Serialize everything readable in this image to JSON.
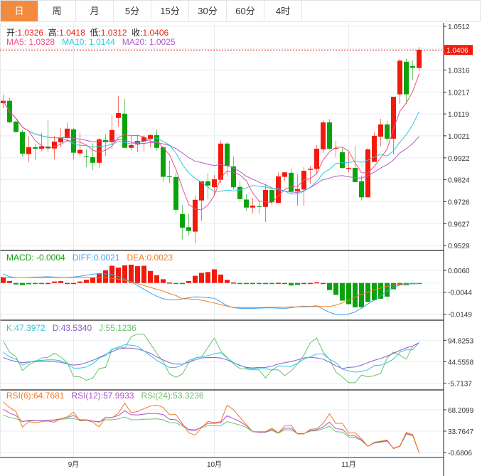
{
  "tabs": [
    {
      "label": "日",
      "active": true
    },
    {
      "label": "周"
    },
    {
      "label": "月"
    },
    {
      "label": "5分"
    },
    {
      "label": "15分"
    },
    {
      "label": "30分"
    },
    {
      "label": "60分"
    },
    {
      "label": "4时"
    }
  ],
  "legend": {
    "open_label": "开:",
    "open": "1.0326",
    "high_label": "高:",
    "high": "1.0418",
    "low_label": "低:",
    "low": "1.0312",
    "close_label": "收:",
    "close": "1.0406",
    "ma5": "MA5: 1.0328",
    "ma10": "MA10: 1.0144",
    "ma20": "MA20: 1.0025",
    "macd": "MACD: -0.0004",
    "diff": "DIFF:0.0021",
    "dea": "DEA:0.0023",
    "k": "K:47.3972",
    "d": "D:43.5340",
    "j": "J:55.1236",
    "rsi6": "RSI(6):64.7681",
    "rsi12": "RSI(12):57.9933",
    "rsi24": "RSI(24):53.3236"
  },
  "colors": {
    "up": "#f21a0a",
    "down": "#0ba30b",
    "ma5": "#f0508a",
    "ma10": "#2fc6dc",
    "ma20": "#b35ccb",
    "diff": "#3fa3f0",
    "dea": "#f57a1f",
    "k": "#2fc6dc",
    "d": "#8a5cd0",
    "j": "#6cc06c",
    "rsi6": "#f57a1f",
    "rsi12": "#b04fd0",
    "rsi24": "#6cc06c",
    "tab_active": "#f28b3e"
  },
  "chart_data": [
    {
      "type": "candlestick",
      "title": "Daily K-line",
      "current_price": "1.0406",
      "y_ticks": [
        "1.0512",
        "1.0316",
        "1.0217",
        "1.0119",
        "1.0021",
        "0.9922",
        "0.9824",
        "0.9726",
        "0.9627",
        "0.9529"
      ],
      "ylim": [
        0.9529,
        1.0512
      ],
      "x_ticks": [
        {
          "label": "9月",
          "index": 11
        },
        {
          "label": "10月",
          "index": 33
        },
        {
          "label": "11月",
          "index": 54
        }
      ],
      "ma_periods": [
        5,
        10,
        20
      ],
      "ohlc_columns": [
        "open",
        "close",
        "high",
        "low"
      ],
      "ohlc": [
        [
          1.0167,
          1.0178,
          1.0206,
          1.0145
        ],
        [
          1.0178,
          1.0082,
          1.019,
          1.0078
        ],
        [
          1.0085,
          1.0038,
          1.0095,
          1.0034
        ],
        [
          1.0038,
          0.9941,
          1.0047,
          0.9928
        ],
        [
          0.9939,
          0.997,
          1.0018,
          0.9903
        ],
        [
          0.997,
          0.9963,
          0.9982,
          0.9912
        ],
        [
          0.9963,
          0.9974,
          1.0034,
          0.9951
        ],
        [
          0.9973,
          0.9966,
          1.009,
          0.9947
        ],
        [
          0.9964,
          0.9995,
          1.0021,
          0.9916
        ],
        [
          0.9992,
          1.0014,
          1.0056,
          0.9969
        ],
        [
          1.0011,
          1.0053,
          1.008,
          0.9994
        ],
        [
          1.005,
          0.9945,
          1.0056,
          0.9915
        ],
        [
          0.9942,
          0.9958,
          1.0034,
          0.9928
        ],
        [
          0.9929,
          0.9927,
          0.996,
          0.988
        ],
        [
          0.9925,
          0.99,
          0.9987,
          0.9867
        ],
        [
          0.99,
          1.0005,
          1.0011,
          0.9877
        ],
        [
          1.0002,
          0.9992,
          1.0029,
          0.9931
        ],
        [
          0.9992,
          1.0047,
          1.0114,
          0.996
        ],
        [
          1.0101,
          1.0123,
          1.0199,
          1.0061
        ],
        [
          1.012,
          0.9967,
          1.0187,
          0.9967
        ],
        [
          0.9967,
          0.9979,
          1.0024,
          0.9955
        ],
        [
          0.9982,
          0.9998,
          1.0024,
          0.9947
        ],
        [
          0.9995,
          1.0015,
          1.0024,
          0.995
        ],
        [
          1.0008,
          1.0024,
          1.0029,
          0.9969
        ],
        [
          1.0024,
          0.9967,
          1.005,
          0.9955
        ],
        [
          0.997,
          0.9837,
          0.997,
          0.9813
        ],
        [
          0.984,
          0.9836,
          0.9909,
          0.9809
        ],
        [
          0.9836,
          0.9689,
          0.9854,
          0.9671
        ],
        [
          0.967,
          0.9609,
          0.971,
          0.9556
        ],
        [
          0.9611,
          0.9594,
          0.9672,
          0.9572
        ],
        [
          0.9591,
          0.9734,
          0.9753,
          0.954
        ],
        [
          0.9731,
          0.9817,
          0.9817,
          0.9639
        ],
        [
          0.9817,
          0.9798,
          0.9854,
          0.9737
        ],
        [
          0.979,
          0.9826,
          0.9845,
          0.9758
        ],
        [
          0.9824,
          0.9986,
          1.0001,
          0.9809
        ],
        [
          0.9986,
          0.9887,
          0.9995,
          0.9838
        ],
        [
          0.9884,
          0.979,
          0.9928,
          0.9779
        ],
        [
          0.9792,
          0.9737,
          0.9817,
          0.9726
        ],
        [
          0.9735,
          0.9699,
          0.9758,
          0.9684
        ],
        [
          0.9699,
          0.9708,
          0.9742,
          0.9673
        ],
        [
          0.9705,
          0.9703,
          0.9731,
          0.9671
        ],
        [
          0.9702,
          0.9778,
          0.9803,
          0.9634
        ],
        [
          0.9778,
          0.9723,
          0.9779,
          0.9707
        ],
        [
          0.972,
          0.9839,
          0.9856,
          0.9718
        ],
        [
          0.9837,
          0.9857,
          0.9859,
          0.9817
        ],
        [
          0.9855,
          0.9771,
          0.9875,
          0.9758
        ],
        [
          0.9772,
          0.9782,
          0.9848,
          0.9708
        ],
        [
          0.978,
          0.9864,
          0.988,
          0.9707
        ],
        [
          0.9868,
          0.9873,
          0.9886,
          0.9806
        ],
        [
          0.9872,
          0.9963,
          0.9979,
          0.9852
        ],
        [
          0.996,
          1.0081,
          1.009,
          0.9944
        ],
        [
          1.0081,
          0.9963,
          1.0096,
          0.9958
        ],
        [
          0.9963,
          0.9966,
          0.9999,
          0.9926
        ],
        [
          0.9947,
          0.9877,
          0.9966,
          0.9873
        ],
        [
          0.9873,
          0.9877,
          0.9947,
          0.9856
        ],
        [
          0.9877,
          0.9813,
          0.9976,
          0.9813
        ],
        [
          0.9817,
          0.9745,
          0.9843,
          0.9731
        ],
        [
          0.9745,
          0.996,
          0.9966,
          0.9745
        ],
        [
          0.9904,
          1.0021,
          1.0037,
          0.9904
        ],
        [
          1.0017,
          1.0072,
          1.0098,
          0.9974
        ],
        [
          1.0072,
          1.0008,
          1.0088,
          0.9997
        ],
        [
          1.0008,
          1.0196,
          1.0196,
          0.9937
        ],
        [
          1.0207,
          1.0358,
          1.0366,
          1.0164
        ],
        [
          1.0353,
          1.0207,
          1.0366,
          1.0164
        ],
        [
          1.0334,
          1.0326,
          1.0359,
          1.027
        ],
        [
          1.0325,
          1.0407,
          1.0419,
          1.0311
        ]
      ]
    },
    {
      "type": "bar+line",
      "title": "MACD",
      "y_ticks": [
        "0.0060",
        "-0.0044",
        "-0.0149"
      ],
      "ylim": [
        -0.0155,
        0.0095
      ],
      "histogram": [
        0.0028,
        0.0009,
        -0.0007,
        -0.001,
        -0.0006,
        -0.0004,
        -0.0003,
        0.0,
        0.0007,
        0.0009,
        0.0,
        0.0,
        0.0007,
        0.0015,
        0.0024,
        0.0046,
        0.006,
        0.0082,
        0.0073,
        0.0084,
        0.0087,
        0.008,
        0.0082,
        0.0057,
        0.0037,
        0.0018,
        0.0002,
        -0.0003,
        -0.0003,
        0.0009,
        0.0034,
        0.0048,
        0.0052,
        0.0065,
        0.004,
        0.0015,
        0.0002,
        -0.0003,
        -0.0003,
        -0.0003,
        -0.0003,
        -0.0003,
        -0.0003,
        0.0001,
        -0.0003,
        -0.0012,
        -0.0009,
        0.0,
        0.0,
        0.0003,
        0.0,
        -0.0034,
        -0.0057,
        -0.0084,
        -0.0101,
        -0.0116,
        -0.0116,
        -0.009,
        -0.0082,
        -0.0075,
        -0.0065,
        -0.003,
        -0.0011,
        -0.0011,
        -0.0006,
        -0.0004
      ],
      "diff": [
        0.0043,
        0.003,
        0.0026,
        0.0026,
        0.0027,
        0.0028,
        0.0029,
        0.003,
        0.0028,
        0.0027,
        0.0027,
        0.0029,
        0.0032,
        0.0037,
        0.0042,
        0.0043,
        0.0043,
        0.004,
        0.003,
        0.0018,
        0.0005,
        -0.0012,
        -0.003,
        -0.0048,
        -0.0063,
        -0.0075,
        -0.008,
        -0.0081,
        -0.0076,
        -0.007,
        -0.0066,
        -0.0067,
        -0.007,
        -0.0073,
        -0.009,
        -0.0108,
        -0.0118,
        -0.0121,
        -0.0121,
        -0.0121,
        -0.012,
        -0.0119,
        -0.0119,
        -0.012,
        -0.0121,
        -0.0118,
        -0.0113,
        -0.011,
        -0.0112,
        -0.0108,
        -0.0125,
        -0.014,
        -0.015,
        -0.0152,
        -0.0148,
        -0.0138,
        -0.012,
        -0.01,
        -0.0082,
        -0.006,
        -0.0038,
        -0.002,
        -0.001,
        -0.0006,
        -0.0004,
        -0.0003
      ],
      "dea": [
        0.0026,
        0.0026,
        0.0026,
        0.0026,
        0.0026,
        0.0026,
        0.0026,
        0.0026,
        0.0026,
        0.0026,
        0.0026,
        0.0026,
        0.0026,
        0.0026,
        0.0026,
        0.0026,
        0.0026,
        0.0022,
        0.0018,
        0.0012,
        0.0005,
        -0.0003,
        -0.0012,
        -0.0021,
        -0.003,
        -0.0039,
        -0.005,
        -0.006,
        -0.0075,
        -0.0076,
        -0.0078,
        -0.0082,
        -0.0088,
        -0.0095,
        -0.0103,
        -0.011,
        -0.0116,
        -0.0117,
        -0.0117,
        -0.0117,
        -0.0117,
        -0.0116,
        -0.0116,
        -0.0115,
        -0.0115,
        -0.0114,
        -0.0114,
        -0.0113,
        -0.0113,
        -0.0112,
        -0.0112,
        -0.0112,
        -0.0105,
        -0.0095,
        -0.0082,
        -0.0068,
        -0.0055,
        -0.0043,
        -0.0033,
        -0.0024,
        -0.0016,
        -0.001,
        -0.0006,
        -0.0004,
        -0.0003,
        -0.0002
      ]
    },
    {
      "type": "line",
      "title": "KDJ",
      "y_ticks": [
        "94.8253",
        "44.5558",
        "-5.7137"
      ],
      "ylim": [
        -12,
        112
      ],
      "k": [
        67.2,
        56.2,
        50.6,
        36.8,
        42.4,
        46.8,
        47.9,
        49.0,
        49.0,
        46.8,
        40.7,
        29.7,
        29.7,
        32.4,
        39.6,
        53.4,
        58.9,
        74.4,
        76.6,
        84.9,
        83.2,
        81.0,
        70.0,
        58.9,
        47.9,
        39.6,
        31.3,
        31.3,
        36.8,
        47.9,
        53.4,
        56.2,
        58.9,
        63.3,
        66.1,
        53.4,
        42.4,
        36.8,
        29.7,
        28.6,
        28.6,
        28.6,
        24.7,
        35.2,
        34.1,
        34.1,
        40.7,
        50.6,
        56.2,
        62.8,
        62.8,
        50.6,
        42.4,
        27.5,
        23.0,
        20.3,
        21.4,
        25.8,
        35.7,
        36.8,
        42.4,
        50.6,
        67.2,
        72.7,
        72.7,
        89.3
      ],
      "d": [
        54.5,
        49.0,
        45.1,
        42.4,
        44.0,
        45.1,
        46.2,
        46.2,
        44.6,
        43.5,
        39.6,
        36.8,
        37.9,
        42.4,
        47.9,
        54.5,
        61.7,
        68.3,
        74.4,
        76.6,
        76.6,
        74.4,
        70.0,
        64.4,
        56.2,
        49.0,
        42.4,
        39.0,
        39.0,
        43.5,
        49.0,
        53.4,
        54.5,
        54.5,
        53.4,
        49.0,
        42.4,
        35.7,
        31.3,
        30.2,
        31.3,
        31.3,
        34.1,
        39.6,
        42.4,
        45.1,
        49.0,
        53.4,
        55.1,
        53.4,
        50.6,
        43.5,
        35.2,
        28.6,
        31.3,
        32.4,
        36.8,
        42.4,
        47.9,
        52.3,
        57.8,
        64.4,
        71.1,
        77.1,
        81.0,
        89.3
      ],
      "j": [
        93.1,
        67.2,
        56.2,
        24.1,
        36.8,
        45.1,
        53.4,
        55.1,
        64.4,
        56.2,
        42.4,
        10.3,
        9.2,
        0.9,
        6.5,
        28.6,
        31.3,
        72.7,
        79.9,
        76.6,
        103.1,
        109.7,
        108.6,
        86.5,
        64.4,
        45.1,
        15.9,
        8.1,
        15.9,
        42.4,
        53.4,
        56.2,
        78.2,
        100.3,
        70.0,
        54.5,
        39.6,
        28.6,
        27.5,
        25.8,
        25.8,
        6.5,
        25.8,
        25.8,
        12.0,
        23.0,
        39.6,
        60.0,
        89.3,
        100.3,
        67.2,
        50.6,
        20.3,
        9.2,
        -4.5,
        -4.5,
        13.7,
        9.2,
        12.0,
        17.5,
        53.4,
        67.2,
        60.0,
        50.6,
        81.0,
        89.3
      ]
    },
    {
      "type": "line",
      "title": "RSI",
      "y_ticks": [
        "68.2099",
        "33.7647",
        "-0.6806"
      ],
      "ylim": [
        -6,
        92
      ],
      "rsi6": [
        80.8,
        72.0,
        65.5,
        40.7,
        49.1,
        47.5,
        49.1,
        50.2,
        48.3,
        54.0,
        56.7,
        64.4,
        50.2,
        51.4,
        48.3,
        40.7,
        55.9,
        55.2,
        62.9,
        78.9,
        63.6,
        65.5,
        70.1,
        74.3,
        75.9,
        72.0,
        60.5,
        60.5,
        46.4,
        31.1,
        27.2,
        39.9,
        49.5,
        47.5,
        49.1,
        75.9,
        68.2,
        55.9,
        44.5,
        33.0,
        33.0,
        33.0,
        38.7,
        31.1,
        42.6,
        43.7,
        29.2,
        29.2,
        36.8,
        37.6,
        46.4,
        61.7,
        46.4,
        46.4,
        31.1,
        31.1,
        21.5,
        9.2,
        15.8,
        17.7,
        19.6,
        5.4,
        10.0,
        31.9,
        28.4,
        -0.7
      ],
      "rsi12": [
        69.4,
        62.9,
        59.0,
        49.1,
        51.4,
        51.4,
        51.4,
        51.4,
        51.4,
        54.0,
        55.9,
        59.0,
        52.1,
        52.1,
        50.2,
        48.3,
        55.9,
        55.9,
        59.0,
        66.7,
        60.5,
        59.8,
        61.3,
        62.1,
        62.1,
        60.5,
        52.9,
        52.1,
        44.5,
        36.1,
        34.9,
        40.7,
        46.4,
        46.4,
        47.5,
        58.6,
        54.0,
        49.1,
        42.6,
        33.0,
        32.2,
        32.2,
        36.8,
        31.1,
        38.7,
        38.7,
        29.9,
        29.9,
        34.9,
        36.1,
        40.7,
        48.3,
        37.6,
        36.8,
        27.2,
        26.1,
        19.6,
        9.2,
        15.0,
        16.9,
        18.5,
        6.2,
        10.0,
        29.9,
        27.2,
        -0.7
      ],
      "rsi24": [
        59.8,
        55.9,
        54.0,
        49.5,
        50.2,
        51.0,
        51.4,
        51.4,
        52.1,
        52.9,
        53.7,
        54.0,
        51.4,
        51.4,
        50.2,
        49.1,
        52.1,
        52.1,
        53.7,
        56.7,
        52.1,
        52.1,
        52.9,
        53.3,
        53.7,
        52.1,
        47.5,
        47.2,
        41.8,
        36.8,
        36.1,
        39.5,
        42.6,
        42.6,
        42.6,
        49.1,
        46.4,
        43.7,
        39.9,
        33.0,
        32.2,
        32.2,
        34.9,
        30.3,
        36.1,
        36.1,
        29.9,
        29.9,
        33.8,
        34.5,
        37.6,
        41.8,
        33.0,
        32.2,
        24.6,
        23.4,
        18.5,
        9.2,
        14.6,
        15.8,
        17.7,
        6.2,
        9.2,
        29.2,
        26.5,
        -0.7
      ]
    }
  ]
}
